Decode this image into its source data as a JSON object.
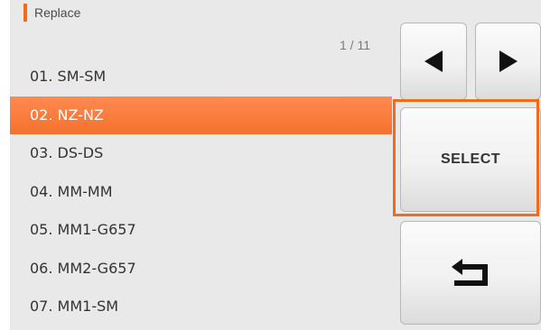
{
  "header": {
    "title": "Replace"
  },
  "pager": {
    "indicator": "1 / 11"
  },
  "list": {
    "items": [
      {
        "label": "01. SM-SM",
        "selected": false
      },
      {
        "label": "02. NZ-NZ",
        "selected": true
      },
      {
        "label": "03. DS-DS",
        "selected": false
      },
      {
        "label": "04. MM-MM",
        "selected": false
      },
      {
        "label": "05. MM1-G657",
        "selected": false
      },
      {
        "label": "06. MM2-G657",
        "selected": false
      },
      {
        "label": "07. MM1-SM",
        "selected": false
      }
    ]
  },
  "buttons": {
    "prev_icon": "arrow-left-icon",
    "next_icon": "arrow-right-icon",
    "select_label": "SELECT",
    "back_icon": "return-icon"
  },
  "colors": {
    "accent": "#f26a1b",
    "selected_row": "#f5712e",
    "background": "#e9e9e9"
  }
}
